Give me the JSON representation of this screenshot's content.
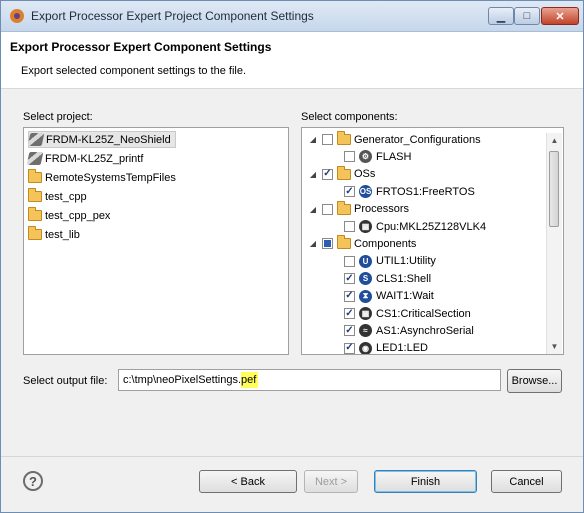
{
  "window": {
    "title": "Export Processor Expert Project Component Settings"
  },
  "header": {
    "title": "Export Processor Expert Component Settings",
    "description": "Export selected component settings to the file."
  },
  "projects": {
    "label": "Select project:",
    "items": [
      {
        "label": "FRDM-KL25Z_NeoShield",
        "icon": "project-icon",
        "selected": true
      },
      {
        "label": "FRDM-KL25Z_printf",
        "icon": "project-icon"
      },
      {
        "label": "RemoteSystemsTempFiles",
        "icon": "folder-icon"
      },
      {
        "label": "test_cpp",
        "icon": "folder-icon"
      },
      {
        "label": "test_cpp_pex",
        "icon": "folder-icon"
      },
      {
        "label": "test_lib",
        "icon": "folder-icon"
      }
    ]
  },
  "components": {
    "label": "Select components:",
    "tree": [
      {
        "label": "Generator_Configurations",
        "level": 0,
        "expanded": true,
        "state": "unchecked",
        "icon": "folder-icon"
      },
      {
        "label": "FLASH",
        "level": 1,
        "state": "unchecked",
        "icon": "gear-icon",
        "color": "#555555"
      },
      {
        "label": "OSs",
        "level": 0,
        "expanded": true,
        "state": "checked",
        "icon": "folder-icon"
      },
      {
        "label": "FRTOS1:FreeRTOS",
        "level": 1,
        "state": "checked",
        "icon": "os-icon",
        "color": "#1f4f9c"
      },
      {
        "label": "Processors",
        "level": 0,
        "expanded": true,
        "state": "unchecked",
        "icon": "folder-icon"
      },
      {
        "label": "Cpu:MKL25Z128VLK4",
        "level": 1,
        "state": "unchecked",
        "icon": "chip-icon",
        "color": "#333333"
      },
      {
        "label": "Components",
        "level": 0,
        "expanded": true,
        "state": "partial",
        "icon": "folder-icon"
      },
      {
        "label": "UTIL1:Utility",
        "level": 1,
        "state": "unchecked",
        "icon": "utility-icon",
        "color": "#1f4f9c"
      },
      {
        "label": "CLS1:Shell",
        "level": 1,
        "state": "checked",
        "icon": "shell-icon",
        "color": "#1f4f9c"
      },
      {
        "label": "WAIT1:Wait",
        "level": 1,
        "state": "checked",
        "icon": "wait-icon",
        "color": "#1f4f9c"
      },
      {
        "label": "CS1:CriticalSection",
        "level": 1,
        "state": "checked",
        "icon": "chip-icon",
        "color": "#333333"
      },
      {
        "label": "AS1:AsynchroSerial",
        "level": 1,
        "state": "checked",
        "icon": "serial-icon",
        "color": "#333333"
      },
      {
        "label": "LED1:LED",
        "level": 1,
        "state": "checked",
        "icon": "led-icon",
        "color": "#333333"
      }
    ]
  },
  "output": {
    "label": "Select output file:",
    "value_prefix": "c:\\tmp\\neoPixelSettings.",
    "value_highlight": "pef",
    "browse_label": "Browse..."
  },
  "footer": {
    "help_icon": "?",
    "back_label": "< Back",
    "next_label": "Next >",
    "finish_label": "Finish",
    "cancel_label": "Cancel"
  },
  "colors": {
    "highlight": "#ffff5a",
    "accent": "#3c7fb1"
  }
}
